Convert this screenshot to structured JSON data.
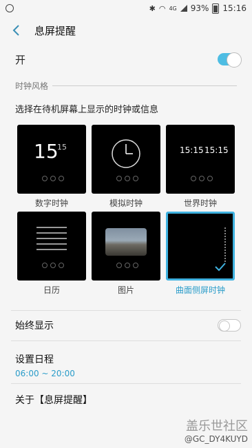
{
  "status_bar": {
    "network": "4G",
    "battery": "93%",
    "time": "15:16"
  },
  "app_bar": {
    "title": "息屏提醒"
  },
  "master_switch": {
    "label": "开",
    "on": true
  },
  "clock_style": {
    "header": "时钟风格",
    "description": "选择在待机屏幕上显示的时钟或信息",
    "tiles": [
      {
        "label": "数字时钟",
        "time_big": "15",
        "time_small": "15",
        "selected": false
      },
      {
        "label": "模拟时钟",
        "selected": false
      },
      {
        "label": "世界时钟",
        "time_a": "15:15",
        "time_b": "15:15",
        "selected": false
      },
      {
        "label": "日历",
        "selected": false
      },
      {
        "label": "图片",
        "selected": false
      },
      {
        "label": "曲面侧屏时钟",
        "selected": true
      }
    ]
  },
  "always_show": {
    "label": "始终显示",
    "on": false
  },
  "schedule": {
    "label": "设置日程",
    "value": "06:00 ~ 20:00"
  },
  "about": {
    "label": "关于【息屏提醒】"
  },
  "watermark": {
    "line1": "盖乐世社区",
    "line2": "@GC_DY4KUYD"
  }
}
